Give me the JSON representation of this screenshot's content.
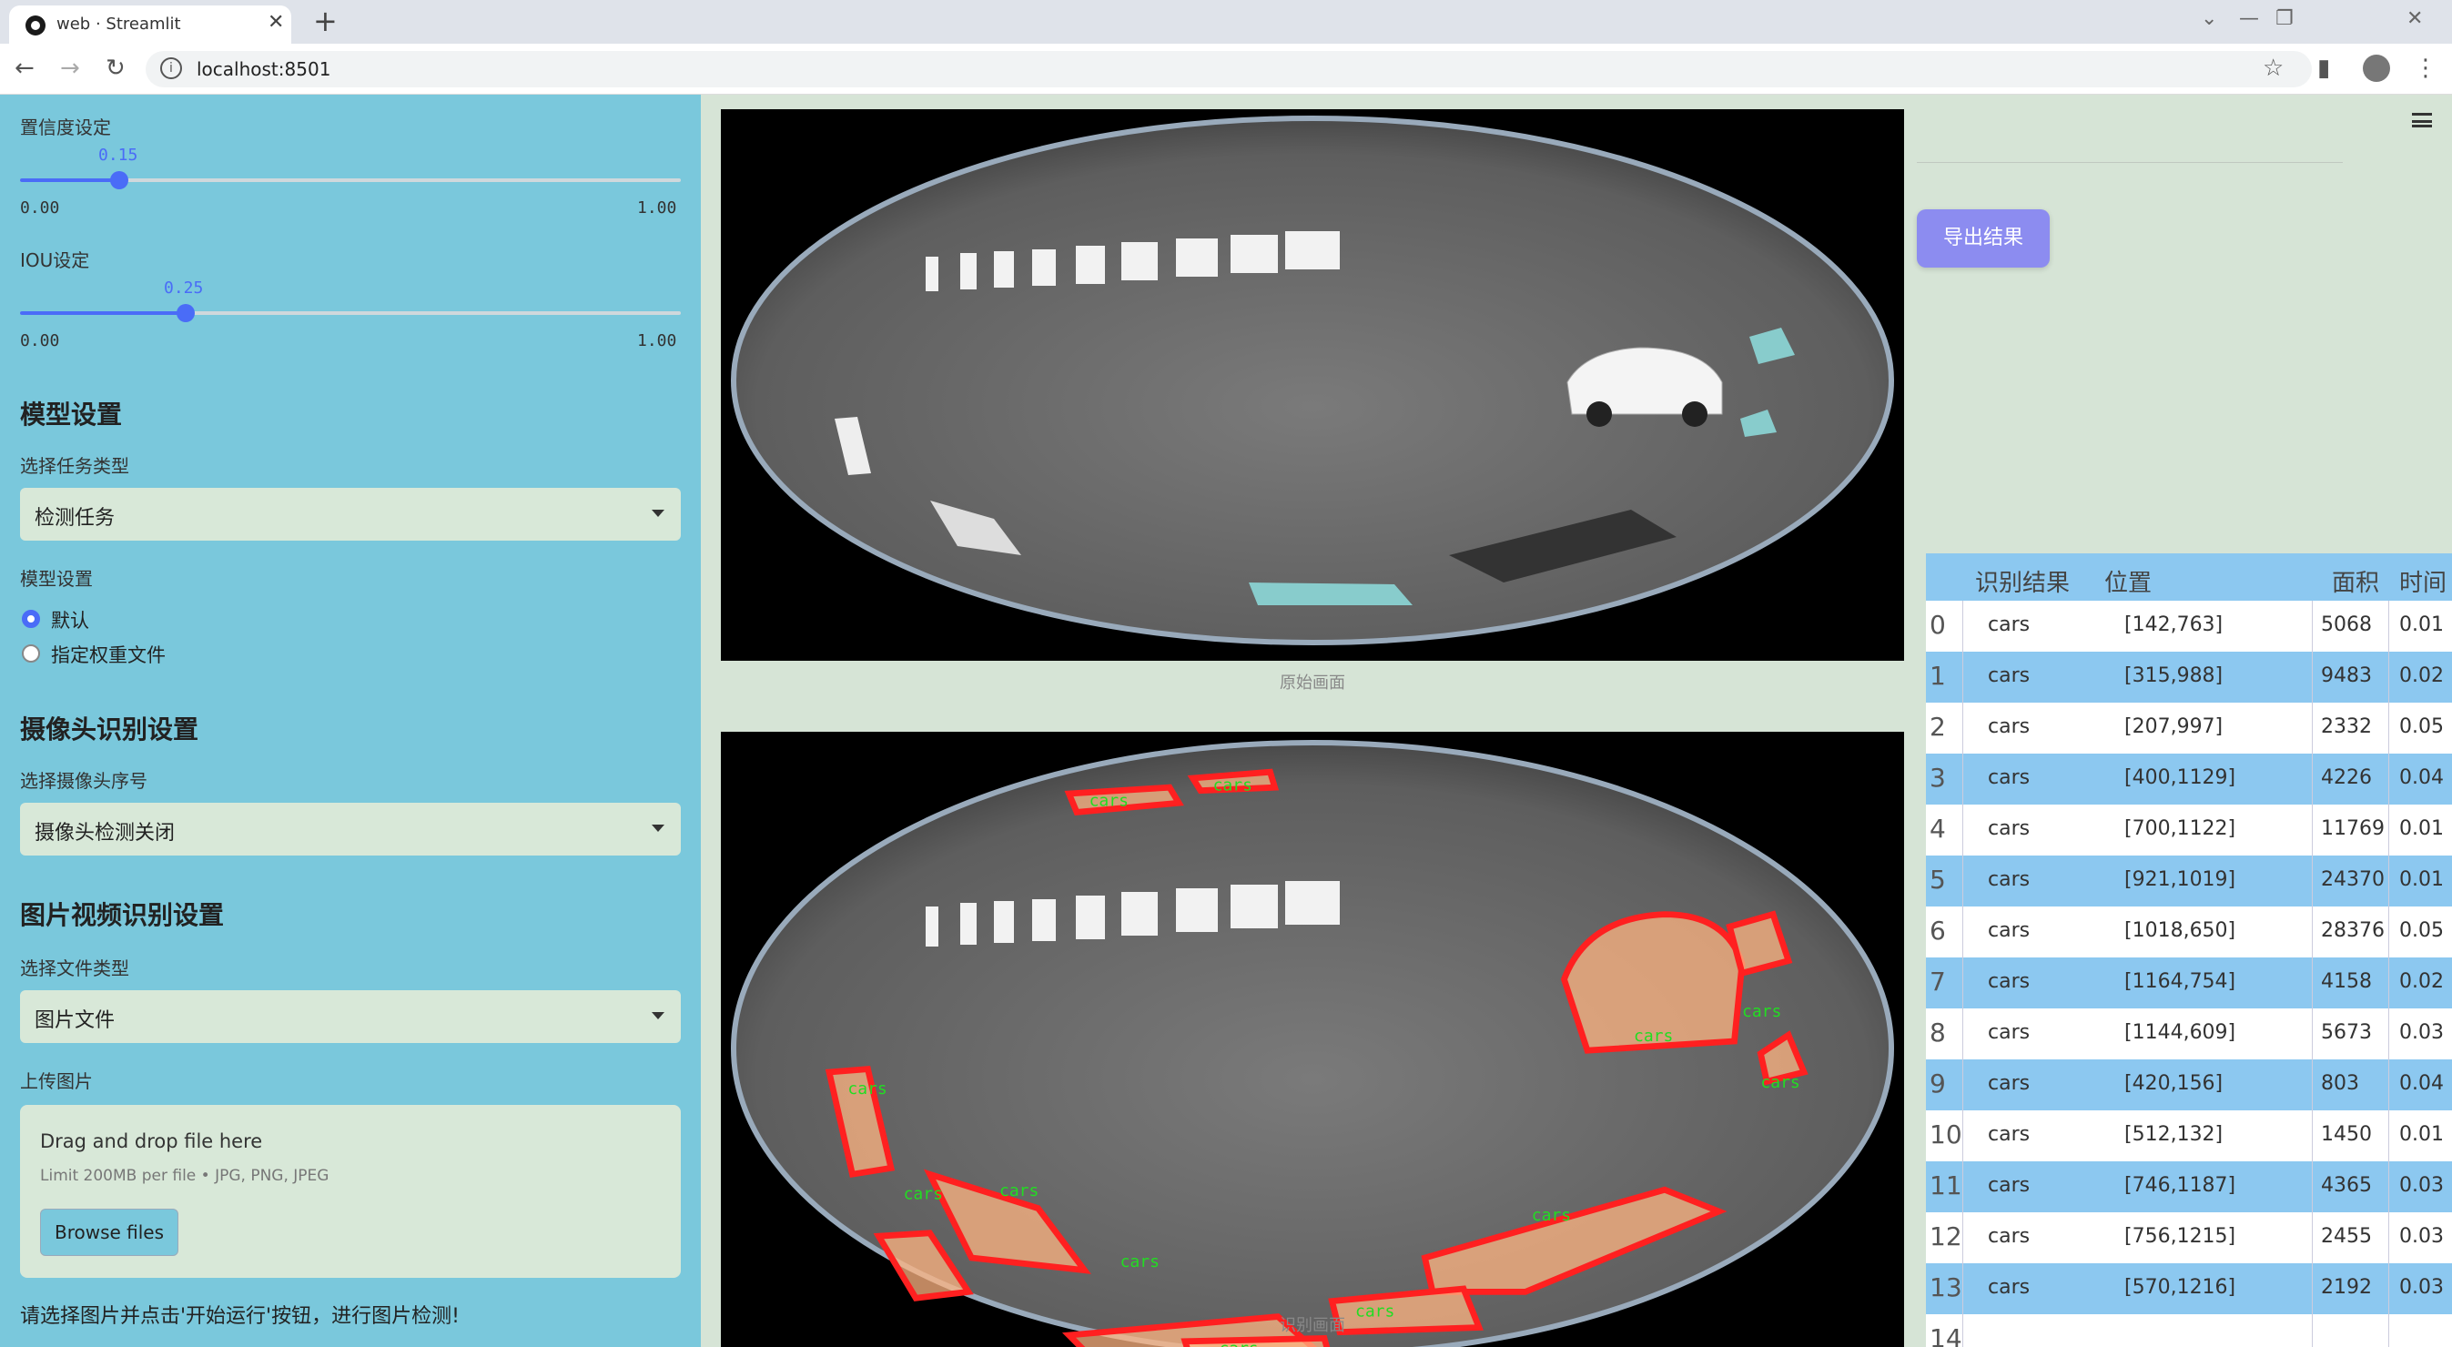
{
  "browser": {
    "tab_title": "web · Streamlit",
    "url": "localhost:8501"
  },
  "sidebar": {
    "confidence": {
      "label": "置信度设定",
      "value": "0.15",
      "min": "0.00",
      "max": "1.00",
      "fraction": 0.15
    },
    "iou": {
      "label": "IOU设定",
      "value": "0.25",
      "min": "0.00",
      "max": "1.00",
      "fraction": 0.25
    },
    "model_heading": "模型设置",
    "task_label": "选择任务类型",
    "task_value": "检测任务",
    "model_label": "模型设置",
    "model_options": [
      "默认",
      "指定权重文件"
    ],
    "model_selected": 0,
    "camera_heading": "摄像头识别设置",
    "camera_label": "选择摄像头序号",
    "camera_value": "摄像头检测关闭",
    "media_heading": "图片视频识别设置",
    "file_type_label": "选择文件类型",
    "file_type_value": "图片文件",
    "upload_label": "上传图片",
    "dropzone_title": "Drag and drop file here",
    "dropzone_limit": "Limit 200MB per file • JPG, PNG, JPEG",
    "browse_label": "Browse files",
    "note": "请选择图片并点击'开始运行'按钮，进行图片检测!"
  },
  "main": {
    "original_caption": "原始画面",
    "result_caption": "识别画面",
    "detection_label": "cars",
    "export_label": "导出结果"
  },
  "table": {
    "headers": [
      "识别结果",
      "位置",
      "面积",
      "时间"
    ],
    "rows": [
      {
        "idx": "0",
        "label": "cars",
        "pos": "[142,763]",
        "area": "5068",
        "time": "0.01"
      },
      {
        "idx": "1",
        "label": "cars",
        "pos": "[315,988]",
        "area": "9483",
        "time": "0.02"
      },
      {
        "idx": "2",
        "label": "cars",
        "pos": "[207,997]",
        "area": "2332",
        "time": "0.05"
      },
      {
        "idx": "3",
        "label": "cars",
        "pos": "[400,1129]",
        "area": "4226",
        "time": "0.04"
      },
      {
        "idx": "4",
        "label": "cars",
        "pos": "[700,1122]",
        "area": "11769",
        "time": "0.01"
      },
      {
        "idx": "5",
        "label": "cars",
        "pos": "[921,1019]",
        "area": "24370",
        "time": "0.01"
      },
      {
        "idx": "6",
        "label": "cars",
        "pos": "[1018,650]",
        "area": "28376",
        "time": "0.05"
      },
      {
        "idx": "7",
        "label": "cars",
        "pos": "[1164,754]",
        "area": "4158",
        "time": "0.02"
      },
      {
        "idx": "8",
        "label": "cars",
        "pos": "[1144,609]",
        "area": "5673",
        "time": "0.03"
      },
      {
        "idx": "9",
        "label": "cars",
        "pos": "[420,156]",
        "area": "803",
        "time": "0.04"
      },
      {
        "idx": "10",
        "label": "cars",
        "pos": "[512,132]",
        "area": "1450",
        "time": "0.01"
      },
      {
        "idx": "11",
        "label": "cars",
        "pos": "[746,1187]",
        "area": "4365",
        "time": "0.03"
      },
      {
        "idx": "12",
        "label": "cars",
        "pos": "[756,1215]",
        "area": "2455",
        "time": "0.03"
      },
      {
        "idx": "13",
        "label": "cars",
        "pos": "[570,1216]",
        "area": "2192",
        "time": "0.03"
      },
      {
        "idx": "14",
        "label": "",
        "pos": "",
        "area": "",
        "time": ""
      }
    ]
  },
  "colors": {
    "sidebar_bg": "#7ac8dc",
    "accent": "#4a6cf7",
    "export_button": "#8c8cf0",
    "detection_outline": "#ff2020",
    "detection_text": "#22dd22"
  }
}
